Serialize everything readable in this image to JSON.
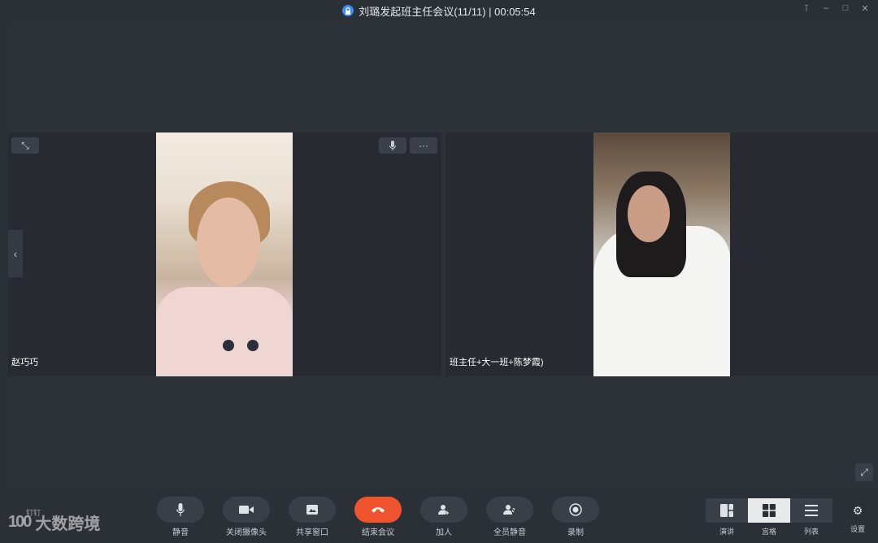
{
  "window": {
    "title": "刘璐发起班主任会议(11/11) | 00:05:54",
    "controls": [
      "pin-icon",
      "minimize-icon",
      "maximize-icon",
      "close-icon"
    ]
  },
  "tiles": [
    {
      "name": "赵巧巧"
    },
    {
      "name": "班主任+大一班+陈梦霞)"
    }
  ],
  "toolbar": {
    "mute": "静音",
    "camera": "关闭摄像头",
    "share": "共享窗口",
    "end": "结束会议",
    "add": "加人",
    "mute_all": "全员静音",
    "record": "录制"
  },
  "views": {
    "speaker": "演讲",
    "grid": "宫格",
    "list": "列表",
    "active": "宫格"
  },
  "settings_label": "设置",
  "watermark": {
    "logo": "100",
    "small": "钉钉",
    "text": "大数跨境"
  },
  "colors": {
    "background": "#2b2f36",
    "end_button": "#f0542f",
    "lock": "#3c8cf2"
  }
}
